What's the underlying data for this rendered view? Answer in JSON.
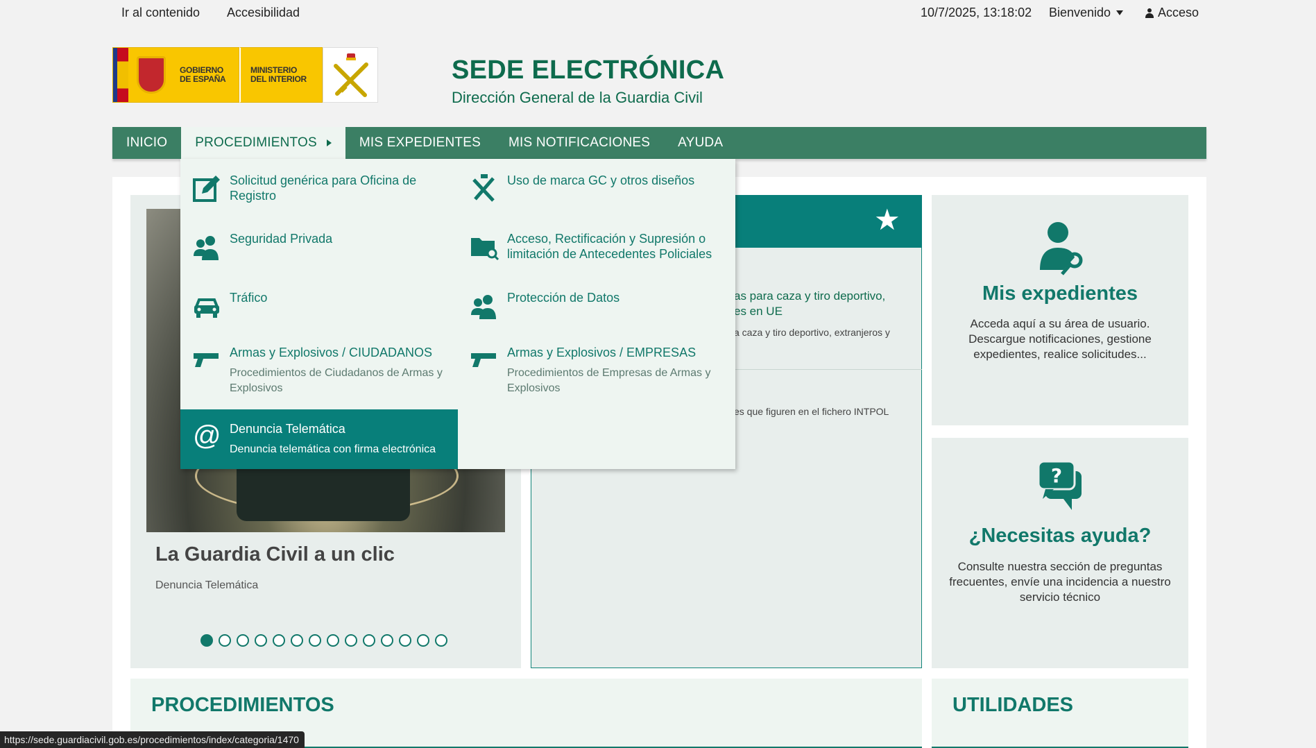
{
  "topbar": {
    "skip_label": "Ir al contenido",
    "accessibility_label": "Accesibilidad",
    "datetime": "10/7/2025, 13:18:02",
    "welcome_label": "Bienvenido",
    "login_label": "Acceso"
  },
  "header": {
    "logo_gob_text_1": "GOBIERNO",
    "logo_gob_text_2": "DE ESPAÑA",
    "logo_min_text_1": "MINISTERIO",
    "logo_min_text_2": "DEL INTERIOR",
    "title": "SEDE ELECTRÓNICA",
    "subtitle": "Dirección General de la Guardia Civil"
  },
  "nav": {
    "items": [
      {
        "label": "INICIO"
      },
      {
        "label": "PROCEDIMIENTOS"
      },
      {
        "label": "MIS EXPEDIENTES"
      },
      {
        "label": "MIS NOTIFICACIONES"
      },
      {
        "label": "AYUDA"
      }
    ]
  },
  "dropdown": {
    "items": [
      {
        "title": "Solicitud genérica para Oficina de Registro",
        "icon": "edit-icon"
      },
      {
        "title": "Uso de marca GC y otros diseños",
        "icon": "gc-emblem-icon"
      },
      {
        "title": "Seguridad Privada",
        "icon": "users-icon"
      },
      {
        "title": "Acceso, Rectificación y Supresión o limitación de Antecedentes Policiales",
        "icon": "folder-search-icon"
      },
      {
        "title": "Tráfico",
        "icon": "car-icon"
      },
      {
        "title": "Protección de Datos",
        "icon": "users-icon"
      },
      {
        "title": "Armas y Explosivos / CIUDADANOS",
        "desc": "Procedimientos de Ciudadanos de Armas y Explosivos",
        "icon": "pistol-icon"
      },
      {
        "title": "Armas y Explosivos / EMPRESAS",
        "desc": "Procedimientos de Empresas de Armas y Explosivos",
        "icon": "pistol-icon"
      }
    ],
    "highlight": {
      "title": "Denuncia Telemática",
      "desc": "Denuncia telemática con firma electrónica",
      "icon": "at-icon",
      "glyph": "@"
    }
  },
  "slider": {
    "title": "La Guardia Civil a un clic",
    "subtitle": "Denuncia Telemática",
    "slide_count": 14,
    "active_slide": 1
  },
  "news": {
    "star_glyph": "★",
    "item1_line1": "as para caza y tiro deportivo,",
    "item1_line2": "es en UE",
    "item1_desc": "a caza y tiro deportivo, extranjeros y",
    "item2_desc": "es que figuren en el fichero INTPOL"
  },
  "cards": {
    "expedientes": {
      "title": "Mis expedientes",
      "text": "Acceda aquí a su área de usuario. Descargue notificaciones, gestione expedientes, realice solicitudes..."
    },
    "ayuda": {
      "title": "¿Necesitas ayuda?",
      "text": "Consulte nuestra sección de preguntas frecuentes, envíe una incidencia a nuestro servicio técnico"
    }
  },
  "sections": {
    "procedimientos": "PROCEDIMIENTOS",
    "utilidades": "UTILIDADES"
  },
  "statusbar": {
    "url": "https://sede.guardiacivil.gob.es/procedimientos/index/categoria/1470"
  },
  "colors": {
    "brand_green": "#3b7f64",
    "accent_teal": "#087f7a",
    "title_green": "#0e6b4d"
  }
}
